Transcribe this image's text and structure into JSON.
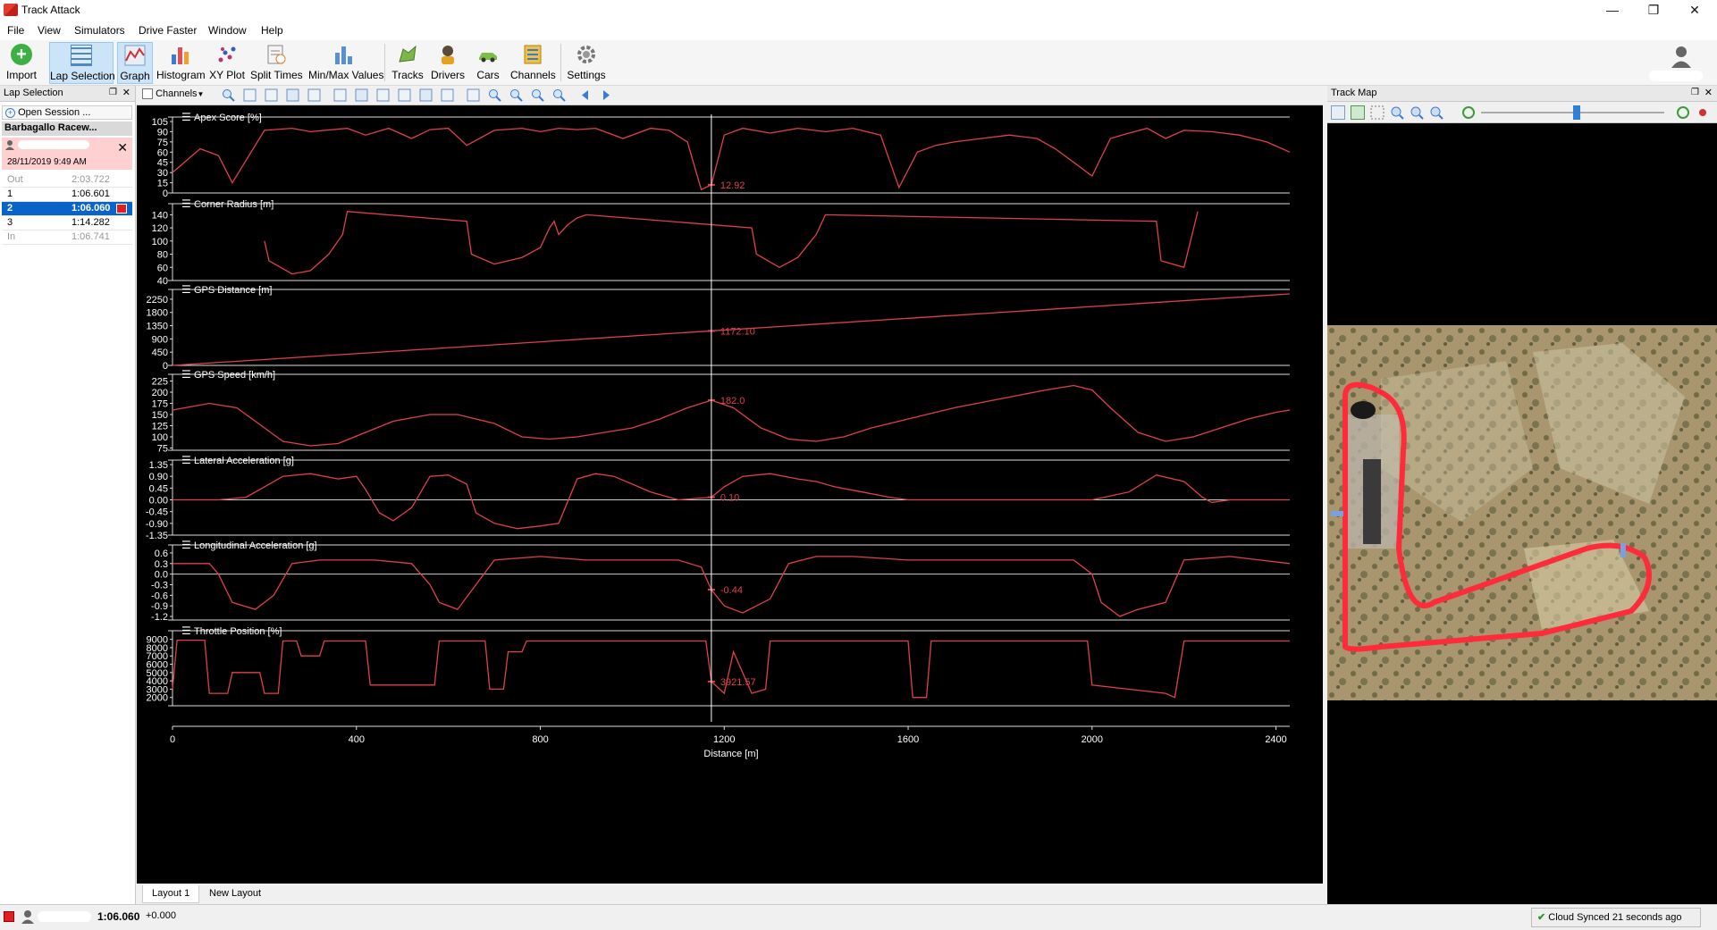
{
  "window": {
    "title": "Track Attack"
  },
  "menu": [
    "File",
    "View",
    "Simulators",
    "Drive Faster",
    "Window",
    "Help"
  ],
  "toolbar": {
    "buttons": [
      {
        "label": "Import",
        "icon": "import-icon"
      },
      {
        "label": "Lap Selection",
        "icon": "lap-selection-icon"
      },
      {
        "label": "Graph",
        "icon": "graph-icon"
      },
      {
        "label": "Histogram",
        "icon": "histogram-icon"
      },
      {
        "label": "XY Plot",
        "icon": "xy-plot-icon"
      },
      {
        "label": "Split Times",
        "icon": "split-times-icon"
      },
      {
        "label": "Min/Max Values",
        "icon": "min-max-icon"
      },
      {
        "label": "Tracks",
        "icon": "tracks-icon"
      },
      {
        "label": "Drivers",
        "icon": "drivers-icon"
      },
      {
        "label": "Cars",
        "icon": "cars-icon"
      },
      {
        "label": "Channels",
        "icon": "channels-icon"
      },
      {
        "label": "Settings",
        "icon": "settings-icon"
      }
    ]
  },
  "lap_selection": {
    "panel_title": "Lap Selection",
    "open_session": "Open Session ...",
    "track_name": "Barbagallo Racew...",
    "session_date": "28/11/2019 9:49 AM",
    "laps": [
      {
        "n": "Out",
        "time": "2:03.722",
        "dim": true
      },
      {
        "n": "1",
        "time": "1:06.601"
      },
      {
        "n": "2",
        "time": "1:06.060",
        "selected": true
      },
      {
        "n": "3",
        "time": "1:14.282"
      },
      {
        "n": "In",
        "time": "1:06.741",
        "dim": true
      }
    ]
  },
  "graph": {
    "channels_label": "Channels",
    "cursor_x": 1172,
    "x_axis": {
      "label": "Distance [m]",
      "ticks": [
        0,
        400,
        800,
        1200,
        1600,
        2000,
        2400
      ],
      "range": [
        0,
        2430
      ]
    },
    "line_color": "#e0404a"
  },
  "chart_data": [
    {
      "type": "line",
      "title": "Apex Score [%]",
      "y_ticks": [
        105,
        90,
        75,
        60,
        45,
        30,
        15,
        0
      ],
      "ylim": [
        0,
        105
      ],
      "cursor_value": "12.92",
      "series": [
        {
          "x": [
            0,
            60,
            100,
            130,
            200,
            260,
            300,
            380,
            420,
            470,
            520,
            560,
            600,
            640,
            700,
            760,
            800,
            840,
            880,
            920,
            980,
            1040,
            1080,
            1120,
            1150,
            1172,
            1200,
            1240,
            1300,
            1360,
            1420,
            1480,
            1540,
            1580,
            1620,
            1660,
            1700,
            1760,
            1820,
            1880,
            1920,
            1960,
            2000,
            2040,
            2080,
            2120,
            2160,
            2200,
            2260,
            2320,
            2380,
            2430
          ],
          "y": [
            30,
            65,
            55,
            15,
            92,
            95,
            90,
            95,
            85,
            95,
            80,
            93,
            95,
            70,
            92,
            95,
            90,
            95,
            93,
            95,
            80,
            95,
            92,
            75,
            5,
            12,
            85,
            95,
            88,
            95,
            90,
            95,
            85,
            8,
            60,
            70,
            75,
            80,
            85,
            80,
            65,
            45,
            25,
            80,
            88,
            95,
            80,
            92,
            90,
            85,
            75,
            60
          ]
        }
      ]
    },
    {
      "type": "line",
      "title": "Corner Radius [m]",
      "y_ticks": [
        140,
        120,
        100,
        80,
        60,
        40
      ],
      "ylim": [
        40,
        150
      ],
      "series": [
        {
          "x": [
            200,
            210,
            260,
            300,
            340,
            370,
            380,
            640,
            650,
            700,
            760,
            800,
            820,
            830,
            840,
            860,
            880,
            900,
            1260,
            1270,
            1320,
            1360,
            1400,
            1420,
            2140,
            2150,
            2200,
            2230
          ],
          "y": [
            100,
            70,
            50,
            55,
            80,
            110,
            145,
            130,
            80,
            65,
            75,
            90,
            120,
            130,
            110,
            125,
            135,
            140,
            120,
            80,
            60,
            75,
            110,
            140,
            130,
            70,
            60,
            145
          ]
        }
      ]
    },
    {
      "type": "line",
      "title": "GPS Distance [m]",
      "y_ticks": [
        2250,
        1800,
        1350,
        900,
        450,
        0
      ],
      "ylim": [
        0,
        2430
      ],
      "cursor_value": "1172.10",
      "series": [
        {
          "x": [
            0,
            2430
          ],
          "y": [
            0,
            2430
          ]
        }
      ]
    },
    {
      "type": "line",
      "title": "GPS Speed [km/h]",
      "y_ticks": [
        225,
        200,
        175,
        150,
        125,
        100,
        75
      ],
      "ylim": [
        70,
        230
      ],
      "cursor_value": "182.0",
      "series": [
        {
          "x": [
            0,
            80,
            140,
            200,
            240,
            300,
            360,
            420,
            480,
            560,
            620,
            700,
            760,
            820,
            880,
            940,
            1000,
            1060,
            1120,
            1172,
            1220,
            1280,
            1340,
            1400,
            1460,
            1520,
            1600,
            1700,
            1800,
            1900,
            1960,
            2000,
            2040,
            2100,
            2160,
            2220,
            2280,
            2340,
            2400,
            2430
          ],
          "y": [
            160,
            175,
            165,
            120,
            90,
            80,
            85,
            110,
            135,
            150,
            150,
            130,
            100,
            95,
            100,
            110,
            120,
            140,
            165,
            182,
            165,
            120,
            95,
            90,
            100,
            120,
            140,
            165,
            185,
            205,
            215,
            205,
            165,
            110,
            90,
            100,
            120,
            140,
            155,
            160
          ]
        }
      ]
    },
    {
      "type": "line",
      "title": "Lateral Acceleration [g]",
      "y_ticks": [
        "1.35",
        "0.90",
        "0.45",
        "0.00",
        "-0.45",
        "-0.90",
        "-1.35"
      ],
      "ylim": [
        -1.35,
        1.35
      ],
      "cursor_value": "0.10",
      "series": [
        {
          "x": [
            0,
            100,
            160,
            200,
            240,
            300,
            360,
            400,
            420,
            450,
            480,
            520,
            560,
            600,
            640,
            660,
            700,
            750,
            800,
            840,
            880,
            920,
            960,
            1000,
            1040,
            1100,
            1172,
            1200,
            1240,
            1300,
            1360,
            1400,
            1440,
            1500,
            1560,
            1600,
            1700,
            1800,
            1900,
            2000,
            2080,
            2140,
            2200,
            2240,
            2260,
            2300,
            2430
          ],
          "y": [
            0,
            0,
            0.1,
            0.5,
            0.9,
            1.0,
            0.8,
            0.9,
            0.4,
            -0.5,
            -0.8,
            -0.3,
            0.9,
            0.95,
            0.6,
            -0.5,
            -0.9,
            -1.1,
            -1.0,
            -0.9,
            0.8,
            1.0,
            0.9,
            0.6,
            0.3,
            0,
            0.1,
            0.5,
            0.9,
            1.0,
            0.8,
            0.7,
            0.5,
            0.3,
            0.1,
            0,
            0,
            0,
            0,
            0,
            0.3,
            0.95,
            0.7,
            0.1,
            -0.1,
            0,
            0
          ]
        }
      ]
    },
    {
      "type": "line",
      "title": "Longitudinal Acceleration [g]",
      "y_ticks": [
        "0.6",
        "0.3",
        "0.0",
        "-0.3",
        "-0.6",
        "-0.9",
        "-1.2"
      ],
      "ylim": [
        -1.3,
        0.7
      ],
      "cursor_value": "-0.44",
      "series": [
        {
          "x": [
            0,
            80,
            100,
            130,
            180,
            220,
            260,
            320,
            380,
            440,
            520,
            560,
            580,
            620,
            660,
            700,
            800,
            900,
            1000,
            1100,
            1150,
            1172,
            1200,
            1240,
            1300,
            1340,
            1400,
            1480,
            1600,
            1700,
            1800,
            1880,
            1960,
            2000,
            2020,
            2060,
            2100,
            2160,
            2200,
            2300,
            2430
          ],
          "y": [
            0.3,
            0.3,
            0,
            -0.8,
            -1.0,
            -0.6,
            0.3,
            0.4,
            0.4,
            0.4,
            0.3,
            -0.3,
            -0.8,
            -1.0,
            -0.3,
            0.4,
            0.5,
            0.4,
            0.4,
            0.4,
            0.2,
            -0.44,
            -0.9,
            -1.1,
            -0.7,
            0.3,
            0.5,
            0.5,
            0.4,
            0.4,
            0.4,
            0.4,
            0.4,
            0.0,
            -0.8,
            -1.2,
            -1.0,
            -0.8,
            0.4,
            0.5,
            0.3
          ]
        }
      ]
    },
    {
      "type": "line",
      "title": "Throttle Position [%]",
      "y_ticks": [
        9000,
        8000,
        7000,
        6000,
        5000,
        4000,
        3000,
        2000
      ],
      "ylim": [
        1000,
        9500
      ],
      "cursor_value": "3921.57",
      "series": [
        {
          "x": [
            0,
            10,
            70,
            80,
            120,
            130,
            190,
            200,
            230,
            240,
            270,
            280,
            320,
            330,
            420,
            430,
            570,
            580,
            680,
            690,
            720,
            730,
            760,
            770,
            1160,
            1172,
            1200,
            1220,
            1260,
            1290,
            1300,
            1340,
            1400,
            1600,
            1610,
            1640,
            1650,
            1700,
            1990,
            2000,
            2160,
            2180,
            2200,
            2430
          ],
          "y": [
            3000,
            8900,
            8900,
            2500,
            2500,
            5000,
            5000,
            2500,
            2500,
            8800,
            8800,
            7000,
            7000,
            8800,
            8800,
            3500,
            3500,
            8800,
            8800,
            3000,
            3000,
            7500,
            7500,
            8800,
            8800,
            3921,
            2500,
            7500,
            2500,
            3000,
            8800,
            8800,
            8800,
            8800,
            2000,
            2000,
            8800,
            8800,
            8800,
            3500,
            2500,
            2000,
            8800,
            8800
          ]
        }
      ]
    }
  ],
  "track_map": {
    "panel_title": "Track Map"
  },
  "layouts": [
    "Layout 1",
    "New Layout"
  ],
  "status": {
    "lap_time": "1:06.060",
    "delta": "+0.000",
    "cloud": "Cloud Synced 21 seconds ago"
  }
}
